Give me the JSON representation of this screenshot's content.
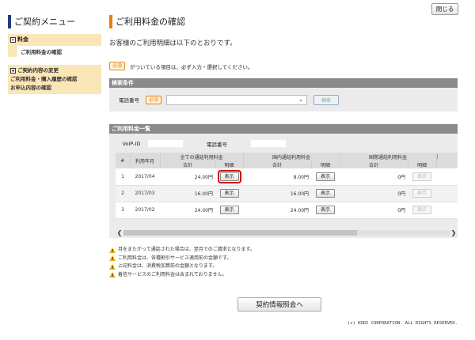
{
  "close_label": "閉じる",
  "sidebar": {
    "title": "ご契約メニュー",
    "group_fee": "料金",
    "group_fee_item": "ご利用料金の確認",
    "items": [
      "ご契約内容の変更",
      "ご利用料金・購入履歴の確認",
      "お申込内容の確認"
    ]
  },
  "main": {
    "title": "ご利用料金の確認",
    "intro": "お客様のご利用明細は以下のとおりです。",
    "required_badge": "必須",
    "required_note": "がついている項目は、必ず入力・選択してください。"
  },
  "search": {
    "header": "検索条件",
    "phone_label": "電話番号",
    "select_value": "",
    "button": "検索"
  },
  "list": {
    "header": "ご利用料金一覧",
    "voip_label": "VoIP-ID",
    "tel_label": "電話番号",
    "col_num": "#",
    "col_month": "利用年月",
    "grp_all": "全ての通話利用料金",
    "grp_domestic": "国内通話利用料金",
    "grp_intl": "国際通話利用料金",
    "sub_total": "合計",
    "sub_detail": "明細",
    "show_label": "表示",
    "rows": [
      {
        "num": "1",
        "month": "2017/04",
        "all": "24.00円",
        "domestic": "8.00円",
        "intl": "0円"
      },
      {
        "num": "2",
        "month": "2017/03",
        "all": "16.00円",
        "domestic": "16.00円",
        "intl": "0円"
      },
      {
        "num": "3",
        "month": "2017/02",
        "all": "24.00円",
        "domestic": "24.00円",
        "intl": "0円"
      }
    ]
  },
  "notes": [
    "月をまたがって通話された場合は、翌月でのご請求となります。",
    "ご利用料金は、各種割引サービス適用前の金額です。",
    "上記料金は、消費税加算前の金額となります。",
    "着信サービスのご利用料金は含まれておりません。"
  ],
  "contract_button": "契約情報照会へ",
  "footer": "(c) KDDI CORPORATION. ALL RIGHTS RESERVED."
}
